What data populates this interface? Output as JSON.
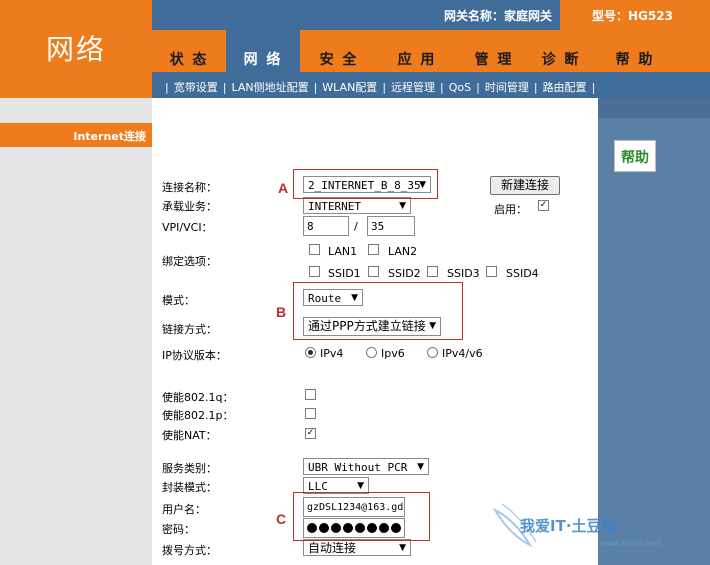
{
  "header": {
    "logo": "网络",
    "gateway_label": "网关名称：家庭网关",
    "model_label": "型号：HG523"
  },
  "nav": {
    "tabs": [
      "状 态",
      "网 络",
      "安 全",
      "应 用",
      "管 理",
      "诊 断",
      "帮 助"
    ],
    "active_index": 1
  },
  "subnav": {
    "items": [
      "宽带设置",
      "LAN侧地址配置",
      "WLAN配置",
      "远程管理",
      "QoS",
      "时间管理",
      "路由配置"
    ]
  },
  "sidebar": {
    "section_title": "Internet连接"
  },
  "help": {
    "title": "帮助"
  },
  "form": {
    "conn_name_label": "连接名称：",
    "conn_name_value": "2_INTERNET_B_8_35",
    "new_conn_button": "新建连接",
    "service_label": "承载业务：",
    "service_value": "INTERNET",
    "enable_label": "启用：",
    "enable_checked": true,
    "vpi_vci_label": "VPI/VCI：",
    "vpi_value": "8",
    "vci_value": "35",
    "vpi_sep": "/",
    "bind_label": "绑定选项：",
    "bind_options": [
      "LAN1",
      "LAN2",
      "SSID1",
      "SSID2",
      "SSID3",
      "SSID4"
    ],
    "mode_label": "模式：",
    "mode_value": "Route",
    "link_label": "链接方式：",
    "link_value": "通过PPP方式建立链接",
    "ip_version_label": "IP协议版本：",
    "ip_versions": [
      "IPv4",
      "Ipv6",
      "IPv4/v6"
    ],
    "ip_version_selected": 0,
    "q8021_label": "使能802.1q：",
    "p8021_label": "使能802.1p：",
    "nat_label": "使能NAT：",
    "nat_checked": true,
    "service_class_label": "服务类别：",
    "service_class_value": "UBR Without PCR",
    "encap_label": "封装模式：",
    "encap_value": "LLC",
    "username_label": "用户名：",
    "username_value": "gzDSL1234@163.gd",
    "password_label": "密码：",
    "password_dots": 8,
    "dial_label": "拨号方式：",
    "dial_value": "自动连接"
  },
  "annotations": {
    "a": "A",
    "b": "B",
    "c": "C"
  },
  "watermark": {
    "text": "我爱IT·土豆兔",
    "sub": "www.tobto.com"
  },
  "colors": {
    "orange": "#ee7b1c",
    "blue": "#3f6c98",
    "annotation_red": "#c0302a"
  }
}
